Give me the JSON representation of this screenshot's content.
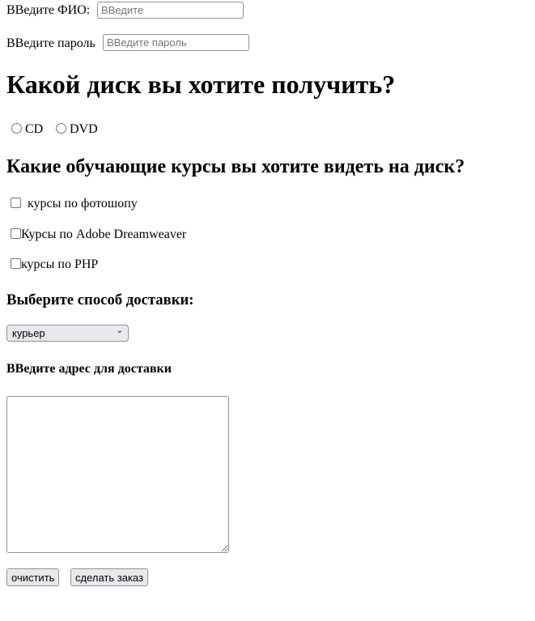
{
  "fio": {
    "label": "ВВедите ФИО:",
    "placeholder": "ВВедите"
  },
  "password": {
    "label": "ВВедите пароль",
    "placeholder": "ВВедите пароль"
  },
  "disk": {
    "heading": "Какой диск вы хотите получить?",
    "options": [
      "CD",
      "DVD"
    ]
  },
  "courses": {
    "heading": "Какие обучающие курсы вы хотите видеть на диск?",
    "items": [
      "курсы по фотошопу",
      "Курсы по Adobe Dreamweaver",
      "курсы по PHP"
    ]
  },
  "delivery": {
    "heading": "Выберите способ доставки:",
    "selected": "курьер"
  },
  "address": {
    "heading": "ВВедите адрес для доставки",
    "value": ""
  },
  "buttons": {
    "reset": "очистить",
    "submit": "сделать заказ"
  }
}
